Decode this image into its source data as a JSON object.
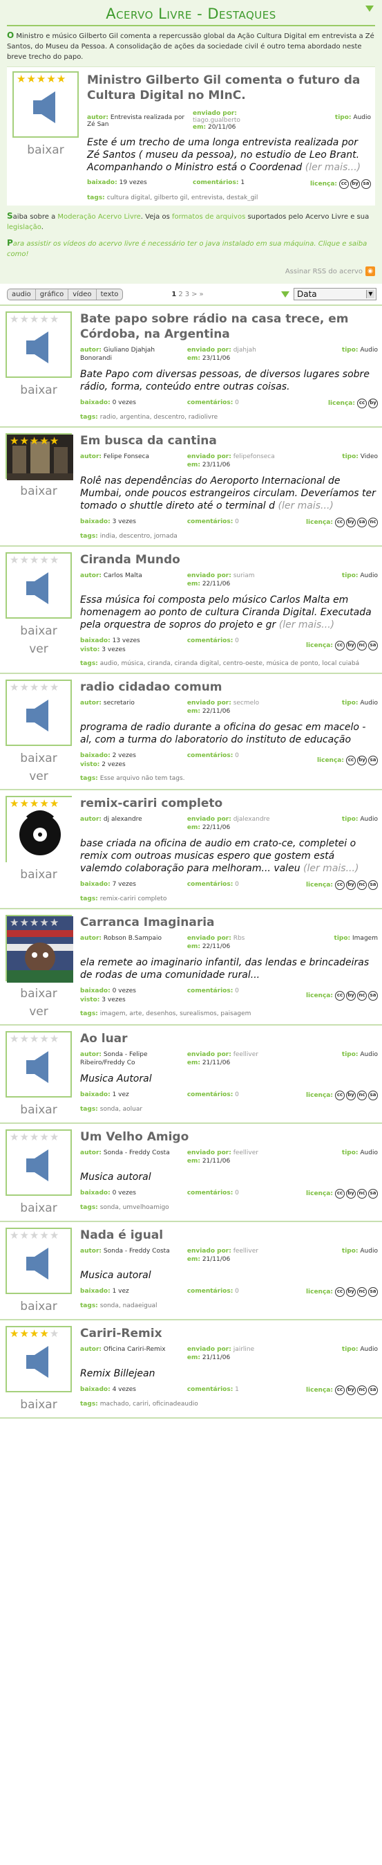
{
  "header": {
    "title": "Acervo Livre - Destaques",
    "intro_dropcap": "O",
    "intro": " Ministro e músico Gilberto Gil comenta a repercussão global da Ação Cultura Digital em entrevista a Zé Santos, do Museu da Pessoa. A consolidação de ações da sociedade civil é outro tema abordado neste breve trecho do papo."
  },
  "featured": {
    "title": "Ministro Gilberto Gil comenta o futuro da Cultura Digital no MInC.",
    "stars": 5,
    "download": "baixar",
    "author_label": "autor:",
    "author": "Entrevista realizada por Zé San",
    "sent_label": "enviado por:",
    "sent_by": "tiago.gualberto",
    "date_label": "em:",
    "date": "20/11/06",
    "type_label": "tipo:",
    "type": "Audio",
    "description": "Este é um trecho de uma longa entrevista realizada por Zé Santos ( museu da pessoa), no estudio de Leo Brant. Acompanhando o Ministro está o Coordenad",
    "more": "(ler mais...)",
    "downloaded_label": "baixado:",
    "downloaded": "19 vezes",
    "comments_label": "comentários:",
    "comments": "1",
    "license_label": "licença:",
    "tags_label": "tags:",
    "tags": "cultura digital, gilberto gil, entrevista, destak_gil"
  },
  "notes": {
    "line1_dropcap": "S",
    "line1_a": "aiba sobre a ",
    "line1_link1": "Moderação Acervo Livre",
    "line1_b": ". Veja os ",
    "line1_link2": "formatos de arquivos",
    "line1_c": " suportados pelo Acervo Livre e sua ",
    "line1_link3": "legislação",
    "line1_d": ".",
    "line2_dropcap": "P",
    "line2": "ara assistir os vídeos do acervo livre é necessário ter o java instalado em sua máquina. Clique e saiba como!",
    "rss": "Assinar RSS do acervo"
  },
  "filter": {
    "tabs": [
      "audio",
      "gráfico",
      "vídeo",
      "texto"
    ],
    "pages": [
      "1",
      "2",
      "3",
      ">",
      "»"
    ],
    "sort_value": "Data"
  },
  "labels": {
    "author": "autor:",
    "sent": "enviado por:",
    "date": "em:",
    "type": "tipo:",
    "downloaded": "baixado:",
    "viewed": "visto:",
    "comments": "comentários:",
    "license": "licença:",
    "tags": "tags:",
    "download": "baixar",
    "view": "ver"
  },
  "items": [
    {
      "title": "Bate papo sobre rádio na casa trece, em Córdoba, na Argentina",
      "stars": 0,
      "thumb": "audio",
      "author": "Giuliano Djahjah Bonorandi",
      "sent_by": "djahjah",
      "date": "23/11/06",
      "type": "Audio",
      "description": "Bate Papo com diversas pessoas, de diversos lugares sobre rádio, forma, conteúdo entre outras coisas.",
      "more": "",
      "downloaded": "0 vezes",
      "viewed": "",
      "comments": "0",
      "license": [
        "cc",
        "by"
      ],
      "tags": "radio, argentina, descentro, radiolivre"
    },
    {
      "title": "Em busca da cantina",
      "stars": 5,
      "thumb": "video",
      "author": "Felipe Fonseca",
      "sent_by": "felipefonseca",
      "date": "23/11/06",
      "type": "Video",
      "description": "Rolê nas dependências do Aeroporto Internacional de Mumbai, onde poucos estrangeiros circulam. Deveríamos ter tomado o shuttle direto até o terminal d",
      "more": "(ler mais...)",
      "downloaded": "3 vezes",
      "viewed": "",
      "comments": "0",
      "license": [
        "cc",
        "by",
        "sa",
        "nc"
      ],
      "tags": "india, descentro, jornada"
    },
    {
      "title": "Ciranda Mundo",
      "stars": 0,
      "thumb": "audio",
      "author": "Carlos Malta",
      "sent_by": "suriam",
      "date": "22/11/06",
      "type": "Audio",
      "description": "Essa música foi composta pelo músico Carlos Malta em homenagem ao ponto de cultura Ciranda Digital. Executada pela orquestra de sopros do projeto e gr",
      "more": "(ler mais...)",
      "downloaded": "13 vezes",
      "viewed": "3 vezes",
      "comments": "0",
      "license": [
        "cc",
        "by",
        "nc",
        "sa"
      ],
      "tags": "audio, música, ciranda, ciranda digital, centro-oeste, música de ponto, local cuiabá"
    },
    {
      "title": "radio cidadao comum",
      "stars": 0,
      "thumb": "audio",
      "author": "secretario",
      "sent_by": "secmelo",
      "date": "22/11/06",
      "type": "Audio",
      "description": "programa de radio durante a oficina do gesac em macelo - al, com a turma do laboratorio do instituto de educação",
      "more": "",
      "downloaded": "2 vezes",
      "viewed": "2 vezes",
      "comments": "0",
      "license": [
        "cc",
        "by",
        "sa"
      ],
      "tags": "Esse arquivo não tem tags."
    },
    {
      "title": "remix-cariri completo",
      "stars": 5,
      "thumb": "dj",
      "author": "dj alexandre",
      "sent_by": "djalexandre",
      "date": "22/11/06",
      "type": "Audio",
      "description": "base criada na oficina de audio em crato-ce, completei o remix com outroas musicas espero que gostem está valemdo colaboração para melhoram... valeu",
      "more": "(ler mais...)",
      "downloaded": "7 vezes",
      "viewed": "",
      "comments": "0",
      "license": [
        "cc",
        "by",
        "nc",
        "sa"
      ],
      "tags": "remix-cariri completo"
    },
    {
      "title": "Carranca Imaginaria",
      "stars": 0,
      "thumb": "art",
      "author": "Robson B.Sampaio",
      "sent_by": "Rbs",
      "date": "22/11/06",
      "type": "Imagem",
      "description": "ela remete ao imaginario infantil, das lendas e brincadeiras de rodas de uma comunidade rural...",
      "more": "",
      "downloaded": "0 vezes",
      "viewed": "3 vezes",
      "comments": "0",
      "license": [
        "cc",
        "by",
        "nc",
        "sa"
      ],
      "tags": "imagem, arte, desenhos, surealismos, paisagem"
    },
    {
      "title": "Ao luar",
      "stars": 0,
      "thumb": "audio",
      "author": "Sonda - Felipe Ribeiro/Freddy Co",
      "sent_by": "feelliver",
      "date": "21/11/06",
      "type": "Audio",
      "description": "Musica Autoral",
      "more": "",
      "downloaded": "1 vez",
      "viewed": "",
      "comments": "0",
      "license": [
        "cc",
        "by",
        "nc",
        "sa"
      ],
      "tags": "sonda, aoluar"
    },
    {
      "title": "Um Velho Amigo",
      "stars": 0,
      "thumb": "audio",
      "author": "Sonda - Freddy Costa",
      "sent_by": "feelliver",
      "date": "21/11/06",
      "type": "Audio",
      "description": "Musica autoral",
      "more": "",
      "downloaded": "0 vezes",
      "viewed": "",
      "comments": "0",
      "license": [
        "cc",
        "by",
        "nc",
        "sa"
      ],
      "tags": "sonda, umvelhoamigo"
    },
    {
      "title": "Nada é igual",
      "stars": 0,
      "thumb": "audio",
      "author": "Sonda - Freddy Costa",
      "sent_by": "feelliver",
      "date": "21/11/06",
      "type": "Audio",
      "description": "Musica autoral",
      "more": "",
      "downloaded": "1 vez",
      "viewed": "",
      "comments": "0",
      "license": [
        "cc",
        "by",
        "nc",
        "sa"
      ],
      "tags": "sonda, nadaeigual"
    },
    {
      "title": "Cariri-Remix",
      "stars": 4,
      "thumb": "audio",
      "author": "Oficina Cariri-Remix",
      "sent_by": "jairline",
      "date": "21/11/06",
      "type": "Audio",
      "description": "Remix Billejean",
      "more": "",
      "downloaded": "4 vezes",
      "viewed": "",
      "comments": "1",
      "license": [
        "cc",
        "by",
        "nc",
        "sa"
      ],
      "tags": "machado, cariri, oficinadeaudio"
    }
  ],
  "colors": {
    "accent": "#7cbf40",
    "title_green": "#3c9a2b",
    "featured_bg": "#eef6e6",
    "star_on": "#f2c200"
  }
}
